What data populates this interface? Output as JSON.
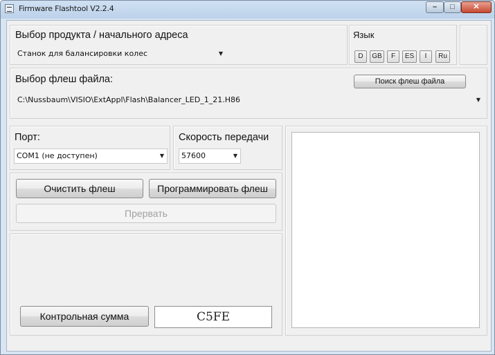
{
  "window": {
    "title": "Firmware Flashtool V2.2.4",
    "min_glyph": "–",
    "max_glyph": "□",
    "close_glyph": "✕"
  },
  "product": {
    "label": "Выбор продукта / начального адреса",
    "selected": "Станок для балансировки колес"
  },
  "language": {
    "label": "Язык",
    "options": [
      "D",
      "GB",
      "F",
      "ES",
      "I",
      "Ru"
    ]
  },
  "flash_file": {
    "label": "Выбор флеш файла:",
    "search_button": "Поиск флеш файла",
    "path": "C:\\Nussbaum\\VISIO\\ExtAppl\\Flash\\Balancer_LED_1_21.H86"
  },
  "port": {
    "label": "Порт:",
    "selected": "COM1 (не доступен)"
  },
  "baud": {
    "label": "Скорость передачи",
    "selected": "57600"
  },
  "actions": {
    "clear_flash": "Очистить флеш",
    "program_flash": "Программировать флеш",
    "abort": "Прервать"
  },
  "checksum": {
    "button": "Контрольная сумма",
    "value": "C5FE"
  }
}
